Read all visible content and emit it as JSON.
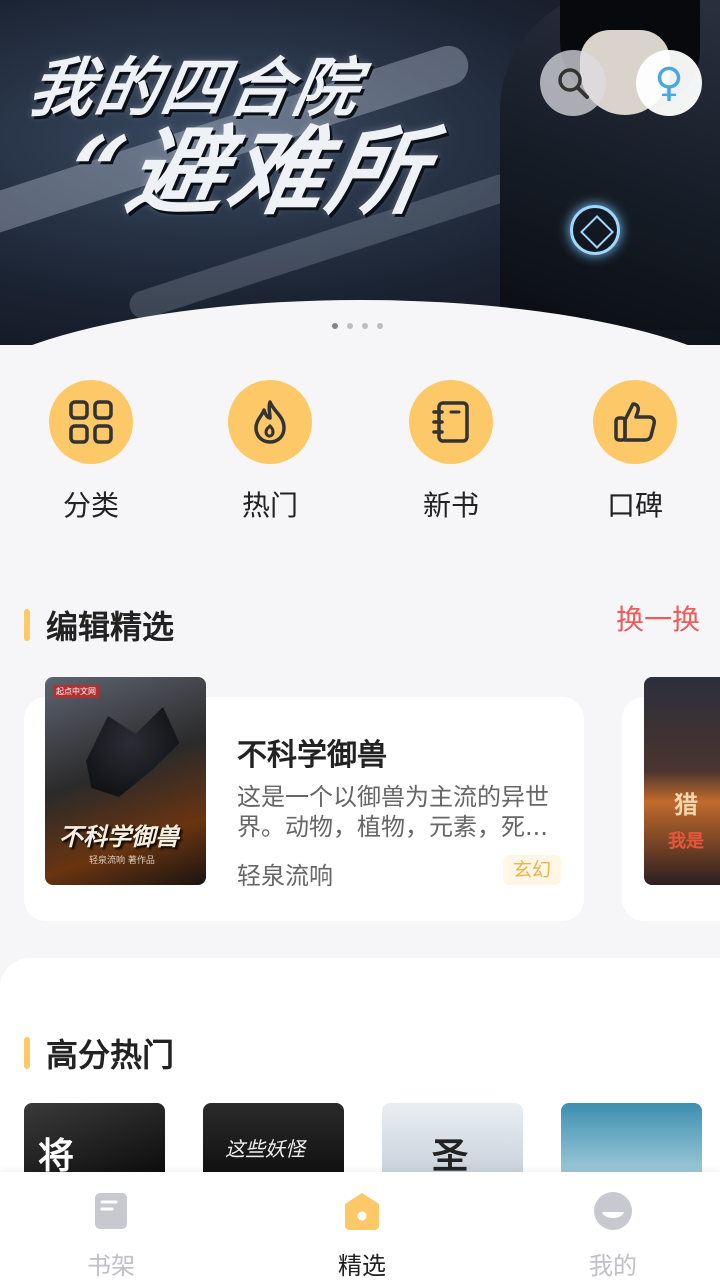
{
  "banner": {
    "title_line1": "我的四合院",
    "title_line2": "“避难所",
    "page_count": 4,
    "active_index": 0
  },
  "top_actions": {
    "search_icon": "search-icon",
    "gender_icon": "female-symbol-icon",
    "gender_glyph": "♀"
  },
  "categories": [
    {
      "label": "分类",
      "icon": "grid-icon"
    },
    {
      "label": "热门",
      "icon": "flame-icon"
    },
    {
      "label": "新书",
      "icon": "notebook-icon"
    },
    {
      "label": "口碑",
      "icon": "thumbs-up-icon"
    }
  ],
  "editor_picks": {
    "title": "编辑精选",
    "refresh_label": "换一换",
    "books": [
      {
        "title": "不科学御兽",
        "description": "这是一个以御兽为主流的异世界。动物，植物，元素，死...",
        "author": "轻泉流响",
        "tag": "玄幻",
        "cover_title": "不科学御兽",
        "cover_author": "轻泉流响 著作品",
        "cover_badge": "起点中文网"
      },
      {
        "cover_title": "猎",
        "cover_subtitle": "我是"
      }
    ]
  },
  "hot": {
    "title": "高分热门",
    "covers": [
      {
        "text": "将"
      },
      {
        "text": "这些妖怪"
      },
      {
        "text": "圣"
      },
      {
        "text": ""
      }
    ]
  },
  "bottom_nav": [
    {
      "label": "书架",
      "icon": "bookshelf-icon",
      "active": false
    },
    {
      "label": "精选",
      "icon": "featured-home-icon",
      "active": true
    },
    {
      "label": "我的",
      "icon": "profile-icon",
      "active": false
    }
  ],
  "colors": {
    "accent": "#fcc868",
    "refresh": "#ef5b5b",
    "tag_text": "#f0b24a",
    "background": "#f6f6f8"
  }
}
